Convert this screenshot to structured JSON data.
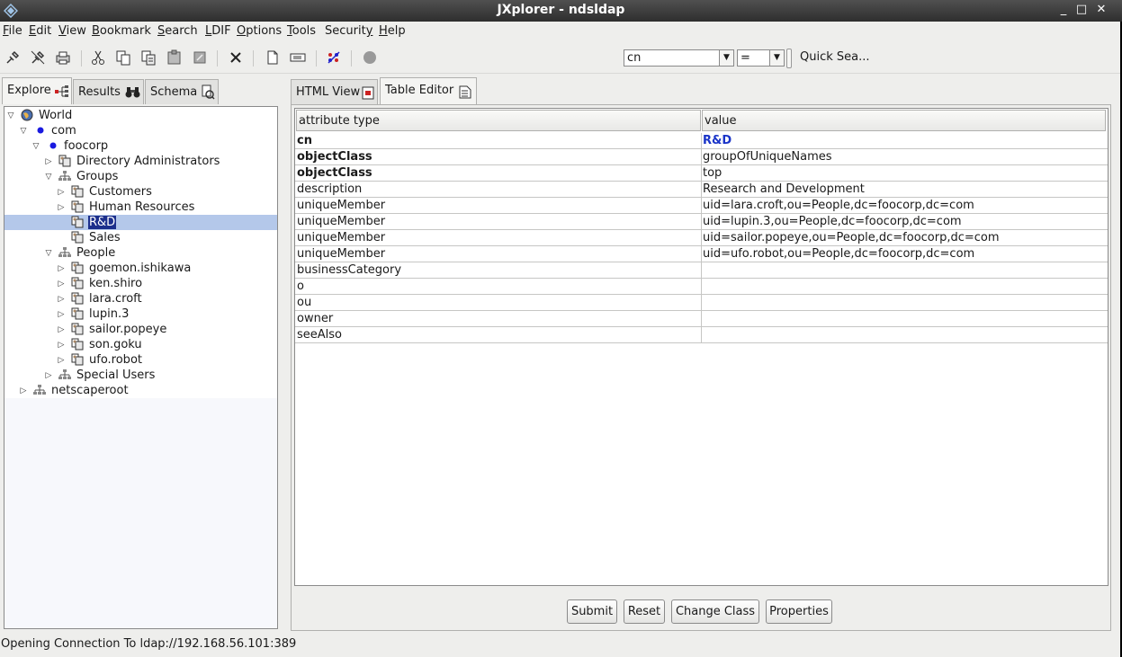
{
  "window": {
    "title": "JXplorer - ndsldap",
    "minimize": "_",
    "maximize": "□",
    "close": "✕"
  },
  "menu": {
    "file": {
      "u": "F",
      "rest": "ile"
    },
    "edit": {
      "u": "E",
      "rest": "dit"
    },
    "view": {
      "u": "V",
      "rest": "iew"
    },
    "bookmark": {
      "u": "B",
      "rest": "ookmark"
    },
    "search": {
      "u": "S",
      "rest": "earch"
    },
    "ldif": {
      "u": "L",
      "rest": "DIF"
    },
    "options": {
      "u": "O",
      "rest": "ptions"
    },
    "tools": {
      "u": "T",
      "rest": "ools"
    },
    "security": {
      "u": "y",
      "pre": "Securit",
      "rest": ""
    },
    "help": {
      "u": "H",
      "rest": "elp"
    }
  },
  "search": {
    "attribute": "cn",
    "operator": "=",
    "quick_label": "Quick Sea..."
  },
  "left_tabs": {
    "explore": "Explore",
    "results": "Results",
    "schema": "Schema"
  },
  "tree": {
    "world": "World",
    "com": "com",
    "foocorp": "foocorp",
    "directory_admins": "Directory Administrators",
    "groups": "Groups",
    "customers": "Customers",
    "human_resources": "Human Resources",
    "rnd": "R&D",
    "sales": "Sales",
    "people": "People",
    "p1": "goemon.ishikawa",
    "p2": "ken.shiro",
    "p3": "lara.croft",
    "p4": "lupin.3",
    "p5": "sailor.popeye",
    "p6": "son.goku",
    "p7": "ufo.robot",
    "special_users": "Special Users",
    "netscaperoot": "netscaperoot"
  },
  "right_tabs": {
    "html_view": "HTML View",
    "table_editor": "Table Editor"
  },
  "table": {
    "col_attr": "attribute type",
    "col_value": "value",
    "rows": [
      {
        "attr": "cn",
        "value": "R&D"
      },
      {
        "attr": "objectClass",
        "value": "groupOfUniqueNames"
      },
      {
        "attr": "objectClass",
        "value": "top"
      },
      {
        "attr": "description",
        "value": "Research and Development"
      },
      {
        "attr": "uniqueMember",
        "value": "uid=lara.croft,ou=People,dc=foocorp,dc=com"
      },
      {
        "attr": "uniqueMember",
        "value": "uid=lupin.3,ou=People,dc=foocorp,dc=com"
      },
      {
        "attr": "uniqueMember",
        "value": "uid=sailor.popeye,ou=People,dc=foocorp,dc=com"
      },
      {
        "attr": "uniqueMember",
        "value": "uid=ufo.robot,ou=People,dc=foocorp,dc=com"
      },
      {
        "attr": "businessCategory",
        "value": ""
      },
      {
        "attr": "o",
        "value": ""
      },
      {
        "attr": "ou",
        "value": ""
      },
      {
        "attr": "owner",
        "value": ""
      },
      {
        "attr": "seeAlso",
        "value": ""
      }
    ]
  },
  "buttons": {
    "submit": "Submit",
    "reset": "Reset",
    "change_class": "Change Class",
    "properties": "Properties"
  },
  "status": "Opening Connection To ldap://192.168.56.101:389",
  "colors": {
    "selection": "#b4c8ea",
    "selected_label": "#1c2f8c",
    "value_highlight": "#1a34c8"
  }
}
